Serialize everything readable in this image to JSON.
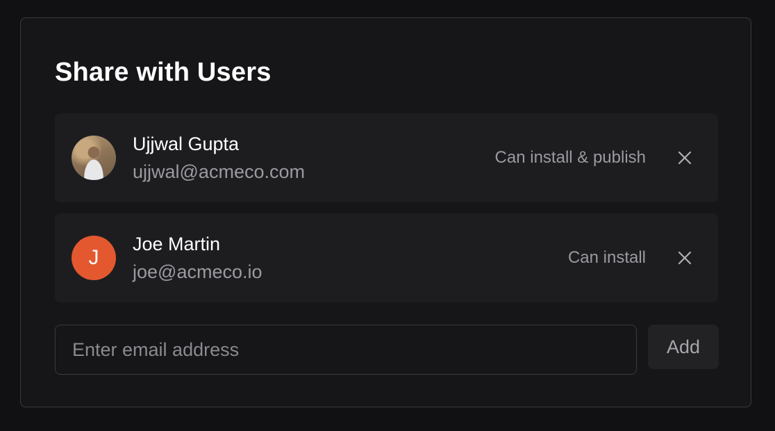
{
  "dialog": {
    "title": "Share with Users"
  },
  "users": [
    {
      "name": "Ujjwal Gupta",
      "email": "ujjwal@acmeco.com",
      "permission": "Can install & publish",
      "avatar_type": "photo"
    },
    {
      "name": "Joe Martin",
      "email": "joe@acmeco.io",
      "permission": "Can install",
      "avatar_type": "initial",
      "avatar_initial": "J",
      "avatar_color": "#e3582f"
    }
  ],
  "input": {
    "placeholder": "Enter email address",
    "value": ""
  },
  "add_button": {
    "label": "Add"
  },
  "icons": {
    "remove": "close-icon"
  },
  "colors": {
    "background": "#111113",
    "panel": "#161618",
    "card": "#1d1d20",
    "muted_text": "#9a9aa0",
    "accent_avatar": "#e3582f"
  }
}
